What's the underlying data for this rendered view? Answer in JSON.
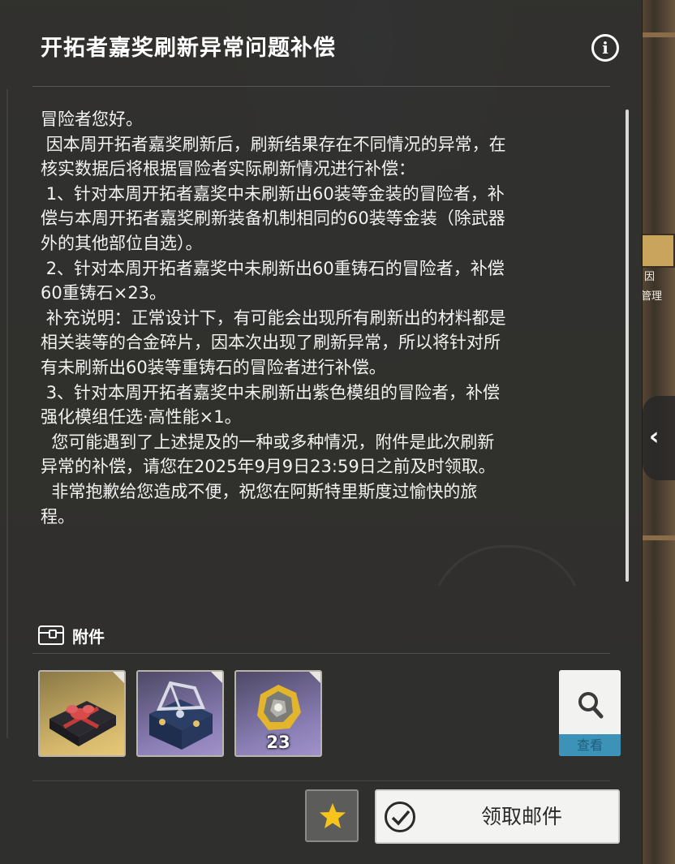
{
  "mail": {
    "title": "开拓者嘉奖刷新异常问题补偿",
    "info_icon_glyph": "i",
    "body_lines": [
      "冒险者您好。",
      " 因本周开拓者嘉奖刷新后，刷新结果存在不同情况的异常，在",
      "核实数据后将根据冒险者实际刷新情况进行补偿：",
      " 1、针对本周开拓者嘉奖中未刷新出60装等金装的冒险者，补",
      "偿与本周开拓者嘉奖刷新装备机制相同的60装等金装（除武器",
      "外的其他部位自选）。",
      " 2、针对本周开拓者嘉奖中未刷新出60重铸石的冒险者，补偿",
      "60重铸石×23。",
      " 补充说明：正常设计下，有可能会出现所有刷新出的材料都是",
      "相关装等的合金碎片，因本次出现了刷新异常，所以将针对所",
      "有未刷新出60装等重铸石的冒险者进行补偿。",
      " 3、针对本周开拓者嘉奖中未刷新出紫色模组的冒险者，补偿",
      "强化模组任选·高性能×1。",
      "  您可能遇到了上述提及的一种或多种情况，附件是此次刷新",
      "异常的补偿，请您在2025年9月9日23:59日之前及时领取。",
      "  非常抱歉给您造成不便，祝您在阿斯特里斯度过愉快的旅",
      "程。"
    ]
  },
  "attachments": {
    "header_label": "附件",
    "items": [
      {
        "name": "gift-box",
        "rarity": "gold",
        "quantity": ""
      },
      {
        "name": "module-chest",
        "rarity": "purple",
        "quantity": ""
      },
      {
        "name": "recast-stone",
        "rarity": "purple",
        "quantity": "23"
      }
    ],
    "view_label": "查看"
  },
  "actions": {
    "claim_label": "领取邮件"
  },
  "background": {
    "side_text_1": "因",
    "side_text_2": "管理"
  },
  "colors": {
    "gold_rarity": "#d3b66b",
    "purple_rarity": "#8b7fb6",
    "view_accent": "#3d92b8",
    "star": "#f7c41c"
  }
}
